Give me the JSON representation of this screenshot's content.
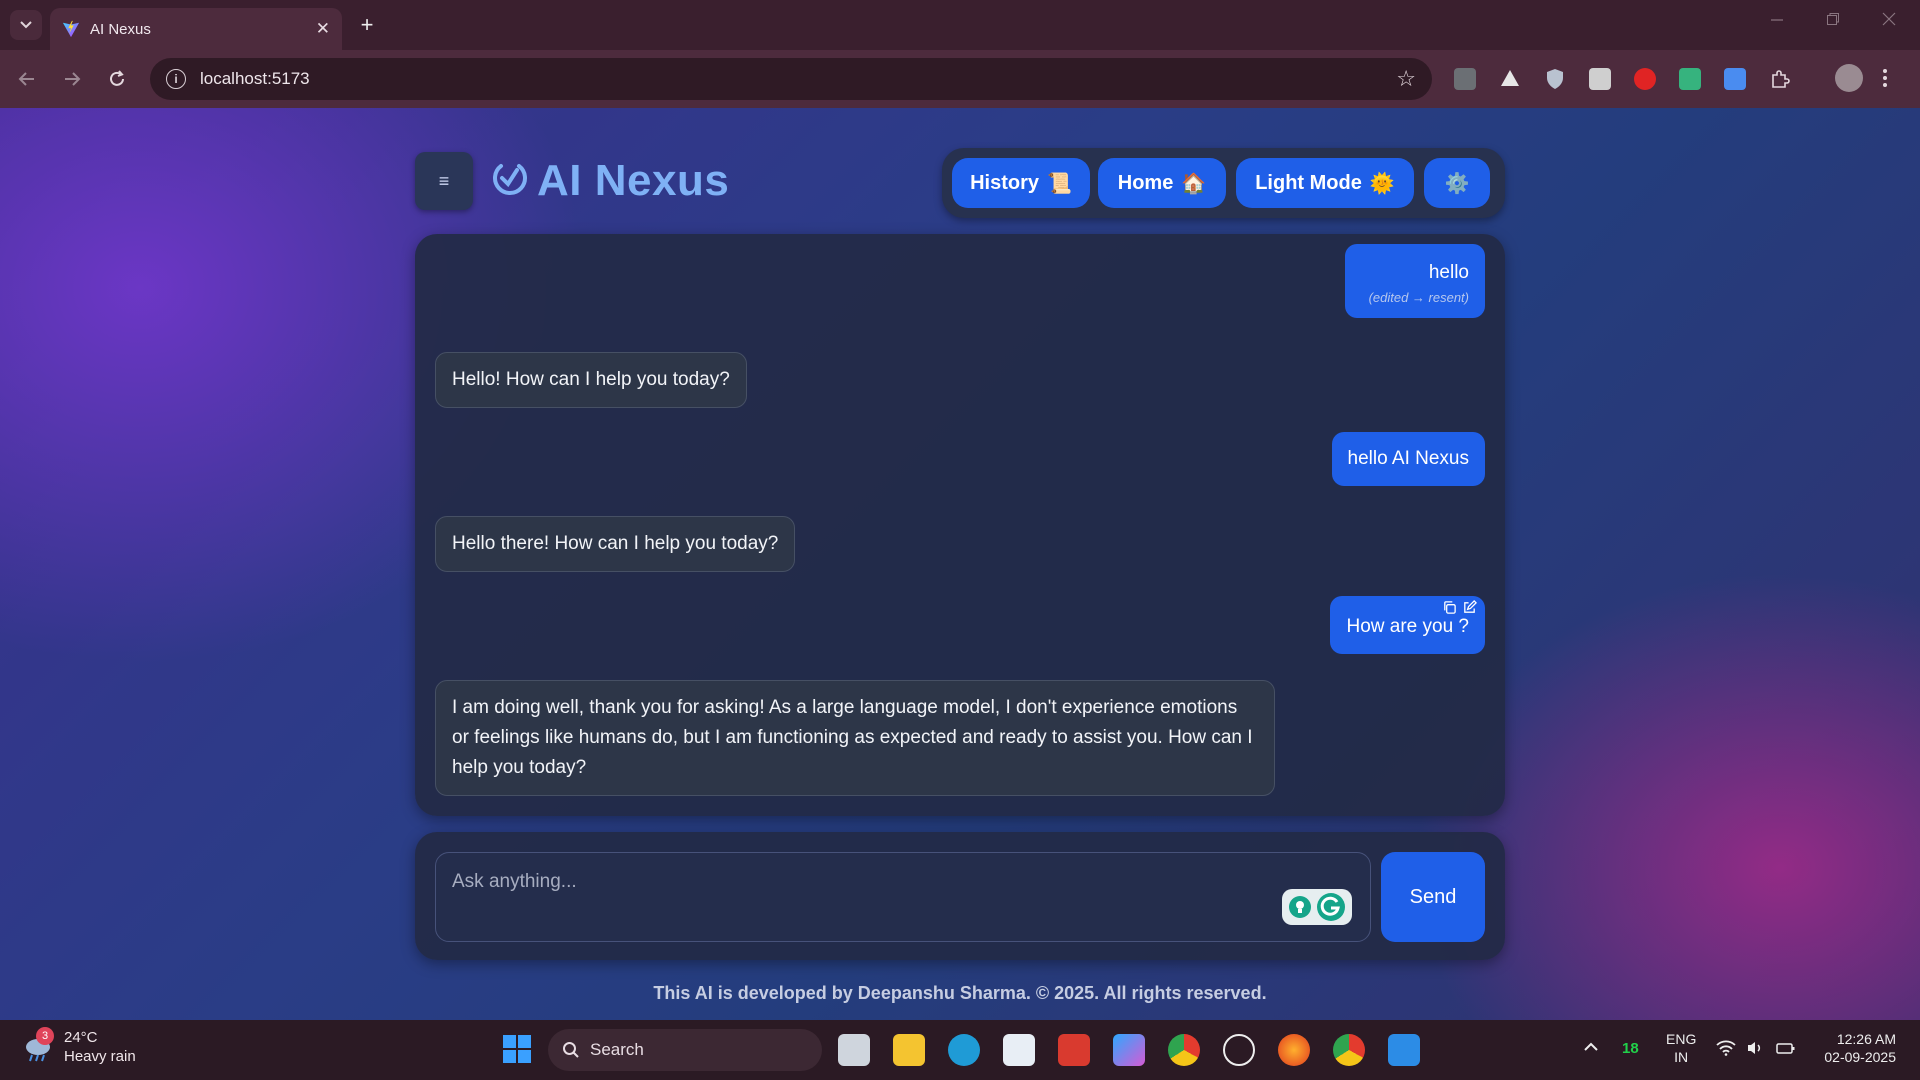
{
  "browser": {
    "tab_title": "AI Nexus",
    "tab_close": "✕",
    "new_tab": "+",
    "tab_search_icon": "chevron-down",
    "url": "localhost:5173"
  },
  "app": {
    "menu_icon": "≡",
    "brand": "AI Nexus",
    "nav": {
      "history": "History",
      "history_emoji": "📜",
      "home": "Home",
      "home_emoji": "🏠",
      "light_mode": "Light Mode",
      "light_mode_emoji": "🌞",
      "settings_emoji": "⚙️"
    },
    "messages": [
      {
        "role": "user",
        "text": "hello",
        "note": "(edited → resent)"
      },
      {
        "role": "bot",
        "text": "Hello! How can I help you today?"
      },
      {
        "role": "user",
        "text": "hello AI Nexus"
      },
      {
        "role": "bot",
        "text": "Hello there! How can I help you today?"
      },
      {
        "role": "user",
        "text": "How are you ?"
      },
      {
        "role": "bot",
        "text": "I am doing well, thank you for asking! As a large language model, I don't experience emotions or feelings like humans do, but I am functioning as expected and ready to assist you. How can I help you today?"
      }
    ],
    "input_placeholder": "Ask anything...",
    "send_label": "Send",
    "footer": "This AI is developed by Deepanshu Sharma. © 2025. All rights reserved."
  },
  "taskbar": {
    "weather_temp": "24°C",
    "weather_desc": "Heavy rain",
    "weather_badge": "3",
    "search_label": "Search",
    "tray_count": "18",
    "lang_top": "ENG",
    "lang_bottom": "IN",
    "time": "12:26 AM",
    "date": "02-09-2025"
  },
  "colors": {
    "accent": "#1f5fe8",
    "brand": "#7fb1f5",
    "panel": "#222a46",
    "bot_bubble": "#2d3648"
  }
}
